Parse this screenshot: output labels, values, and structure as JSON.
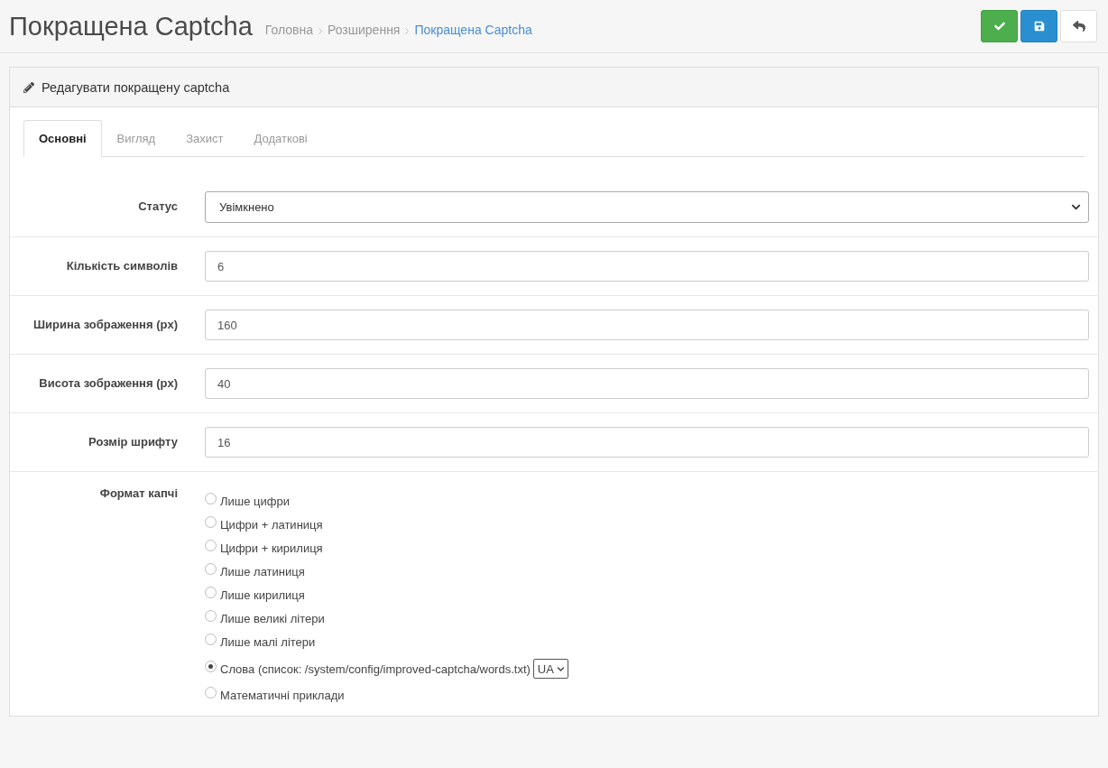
{
  "header": {
    "title": "Покращена Captcha",
    "breadcrumbs": [
      {
        "label": "Головна",
        "current": false
      },
      {
        "label": "Розширення",
        "current": false
      },
      {
        "label": "Покращена Captcha",
        "current": true
      }
    ],
    "actions": [
      {
        "kind": "confirm"
      },
      {
        "kind": "save"
      },
      {
        "kind": "back"
      }
    ]
  },
  "panel": {
    "title": "Редагувати покращену captcha",
    "tabs": [
      {
        "label": "Основні",
        "selected": true
      },
      {
        "label": "Вигляд",
        "selected": false
      },
      {
        "label": "Захист",
        "selected": false
      },
      {
        "label": "Додаткові",
        "selected": false
      }
    ],
    "fields": [
      {
        "kind": "select",
        "label": "Статус",
        "value": "Увімкнено"
      },
      {
        "kind": "input",
        "label": "Кількість символів",
        "value": "6"
      },
      {
        "kind": "input",
        "label": "Ширина зображення (px)",
        "value": "160"
      },
      {
        "kind": "input",
        "label": "Висота зображення (px)",
        "value": "40"
      },
      {
        "kind": "input",
        "label": "Розмір шрифту",
        "value": "16"
      },
      {
        "kind": "radio",
        "label": "Формат капчі",
        "options": [
          {
            "label": "Лише цифри",
            "selected": false
          },
          {
            "label": "Цифри + латиниця",
            "selected": false
          },
          {
            "label": "Цифри + кирилиця",
            "selected": false
          },
          {
            "label": "Лише латиниця",
            "selected": false
          },
          {
            "label": "Лише кирилиця",
            "selected": false
          },
          {
            "label": "Лише великі літери",
            "selected": false
          },
          {
            "label": "Лише малі літери",
            "selected": false
          },
          {
            "label": "Слова (список: /system/config/improved-captcha/words.txt)",
            "selected": true,
            "language": "UA"
          },
          {
            "label": "Математичні приклади",
            "selected": false
          }
        ]
      }
    ]
  }
}
